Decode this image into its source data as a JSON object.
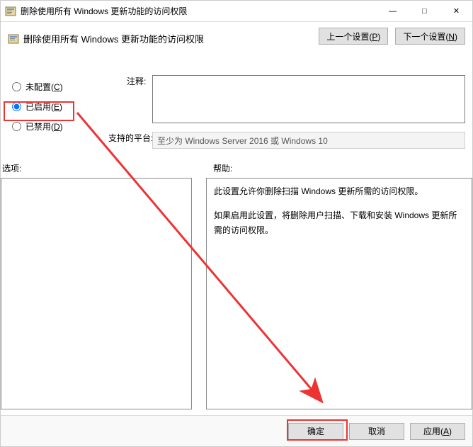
{
  "window": {
    "title": "删除使用所有 Windows 更新功能的访问权限"
  },
  "heading": "删除使用所有 Windows 更新功能的访问权限",
  "nav": {
    "prev": "上一个设置(P)",
    "next": "下一个设置(N)"
  },
  "radios": {
    "not_configured": "未配置(C)",
    "enabled": "已启用(E)",
    "disabled": "已禁用(D)",
    "selected": "enabled"
  },
  "labels": {
    "comment": "注释:",
    "platform": "支持的平台:",
    "options": "选项:",
    "help": "帮助:"
  },
  "comment_text": "",
  "platform_text": "至少为 Windows Server 2016 或 Windows 10",
  "help": {
    "p1": "此设置允许你删除扫描 Windows 更新所需的访问权限。",
    "p2": "如果启用此设置，将删除用户扫描、下载和安装 Windows 更新所需的访问权限。"
  },
  "buttons": {
    "ok": "确定",
    "cancel": "取消",
    "apply": "应用(A)"
  }
}
